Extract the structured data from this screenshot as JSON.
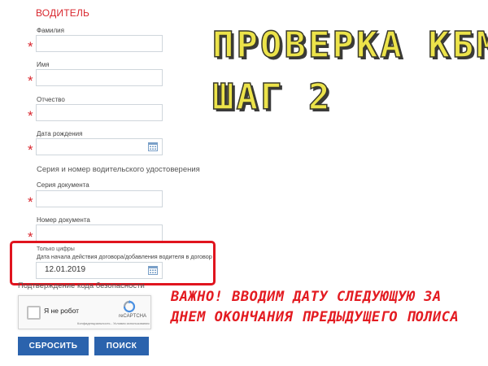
{
  "section_title": "ВОДИТЕЛЬ",
  "fields": {
    "last_name": {
      "label": "Фамилия",
      "value": ""
    },
    "first_name": {
      "label": "Имя",
      "value": ""
    },
    "patronymic": {
      "label": "Отчество",
      "value": ""
    },
    "birth_date": {
      "label": "Дата рождения",
      "value": ""
    },
    "license_series": {
      "label": "Серия документа",
      "value": ""
    },
    "license_number": {
      "label": "Номер документа",
      "value": ""
    },
    "start_date": {
      "label": "Дата начала действия договора/добавления водителя в договор",
      "value": "12.01.2019"
    }
  },
  "license_heading": "Серия и номер водительского удостоверения",
  "required_mark": "*",
  "digits_hint": "Только цифры",
  "security_label": "Подтверждение кода безопасности",
  "captcha": {
    "label": "Я не робот",
    "brand": "reCAPTCHA",
    "terms": "Конфиденциальность - Условия использования"
  },
  "buttons": {
    "reset": "СБРОСИТЬ",
    "search": "ПОИСК"
  },
  "overlay": {
    "title_line1": "ПРОВЕРКА КБМ",
    "title_line2": "ШАГ 2",
    "note_line1": "ВАЖНО! ВВОДИМ ДАТУ СЛЕДУЮЩУЮ ЗА",
    "note_line2": "ДНЕМ ОКОНЧАНИЯ ПРЕДЫДУЩЕГО ПОЛИСА"
  },
  "colors": {
    "accent_red": "#d9282f",
    "button_blue": "#2b63ad",
    "title_yellow": "#ece34a",
    "highlight_red": "#e0141e"
  }
}
